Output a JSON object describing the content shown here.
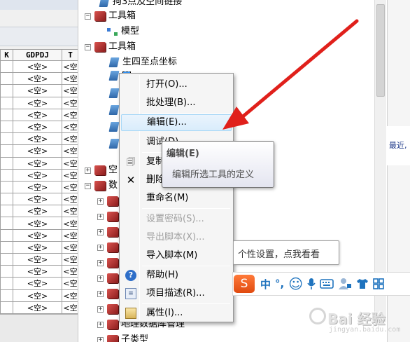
{
  "table": {
    "headers": [
      "K",
      "GDPDJ",
      "T"
    ],
    "rows": [
      [
        "",
        "<空>",
        "<空"
      ],
      [
        "",
        "<空>",
        "<空"
      ],
      [
        "",
        "<空>",
        "<空"
      ],
      [
        "",
        "<空>",
        "<空"
      ],
      [
        "",
        "<空>",
        "<空"
      ],
      [
        "",
        "<空>",
        "<空"
      ],
      [
        "",
        "<空>",
        "<空"
      ],
      [
        "",
        "<空>",
        "<空"
      ],
      [
        "",
        "<空>",
        "<空"
      ],
      [
        "",
        "<空>",
        "<空"
      ],
      [
        "",
        "<空>",
        "<空"
      ],
      [
        "",
        "<空>",
        "<空"
      ],
      [
        "",
        "<空>",
        "<空"
      ],
      [
        "",
        "<空>",
        "<空"
      ],
      [
        "",
        "<空>",
        "<空"
      ],
      [
        "",
        "<空>",
        "<空"
      ],
      [
        "",
        "<空>",
        "<空"
      ],
      [
        "",
        "<空>",
        "<空"
      ],
      [
        "",
        "<空>",
        "<空"
      ],
      [
        "",
        "<空>",
        "<空"
      ],
      [
        "",
        "<空>",
        "<空"
      ],
      [
        "",
        "<空>",
        "<空"
      ]
    ]
  },
  "tree": {
    "top_item": "拘3点及空间链接",
    "toolbox1": "工具箱",
    "model": "模型",
    "toolbox2": "工具箱",
    "tool1": "生四至点坐标",
    "hidden1": "空",
    "hidden2": "数",
    "bottom1": "地理数据库管理",
    "bottom2": "子类型"
  },
  "menu": {
    "open": "打开(O)...",
    "batch": "批处理(B)...",
    "edit": "编辑(E)...",
    "debug": "调试(D)...",
    "copy": "复制",
    "delete": "删除",
    "rename": "重命名(M)",
    "set_password": "设置密码(S)...",
    "export_script": "导出脚本(X)...",
    "import_script": "导入脚本(M)",
    "help": "帮助(H)",
    "description": "项目描述(R)...",
    "properties": "属性(I)..."
  },
  "tooltip": {
    "title": "编辑(E)",
    "description": "编辑所选工具的定义"
  },
  "ime": {
    "bubble": "个性设置，点我看看",
    "logo": "S",
    "lang": "中",
    "punct": "°,",
    "emoji": "☺",
    "mic": "mic-icon",
    "keyboard": "keyboard-icon",
    "user": "user-icon",
    "skin": "skin-icon",
    "tools": "tools-icon"
  },
  "right_panel": {
    "recent": "最近,"
  },
  "watermark": {
    "text": "Bai 经验",
    "sub": "jingyan.baidu.com"
  },
  "colors": {
    "arrow": "#e0201b",
    "menu_hover": "#d9ecfb",
    "ime_logo": "#f0581a"
  }
}
